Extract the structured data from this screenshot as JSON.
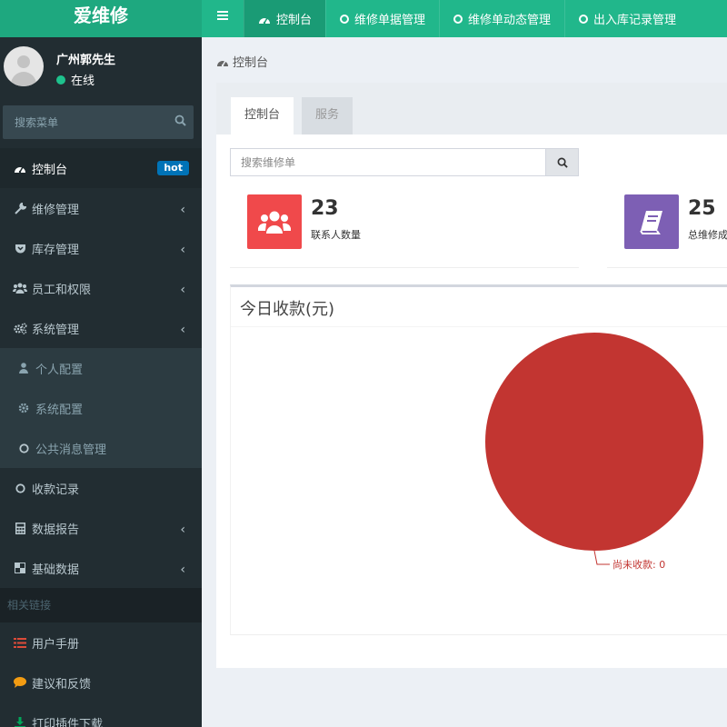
{
  "app": {
    "logo": "爱维修"
  },
  "topnav": {
    "tabs": [
      {
        "label": "控制台",
        "icon": "dashboard-icon",
        "active": true
      },
      {
        "label": "维修单据管理",
        "icon": "circle-icon",
        "active": false
      },
      {
        "label": "维修单动态管理",
        "icon": "circle-icon",
        "active": false
      },
      {
        "label": "出入库记录管理",
        "icon": "circle-icon",
        "active": false
      }
    ]
  },
  "user": {
    "name": "广州郭先生",
    "status": "在线"
  },
  "sidebar": {
    "search_placeholder": "搜索菜单",
    "items": [
      {
        "label": "控制台",
        "icon": "dashboard-icon",
        "badge": "hot",
        "active": true
      },
      {
        "label": "维修管理",
        "icon": "wrench-icon"
      },
      {
        "label": "库存管理",
        "icon": "shield-icon"
      },
      {
        "label": "员工和权限",
        "icon": "users-icon"
      },
      {
        "label": "系统管理",
        "icon": "gears-icon"
      },
      {
        "label": "个人配置",
        "icon": "user-icon"
      },
      {
        "label": "系统配置",
        "icon": "gear-icon"
      },
      {
        "label": "公共消息管理",
        "icon": "circle-icon"
      },
      {
        "label": "收款记录",
        "icon": "circle-icon"
      },
      {
        "label": "数据报告",
        "icon": "calculator-icon"
      },
      {
        "label": "基础数据",
        "icon": "grid-icon"
      }
    ],
    "links_header": "相关链接",
    "links": [
      {
        "label": "用户手册",
        "icon": "list-icon",
        "color": "#dd4b39"
      },
      {
        "label": "建议和反馈",
        "icon": "comment-icon",
        "color": "#f39c12"
      },
      {
        "label": "打印插件下载",
        "icon": "download-icon",
        "color": "#00a65a"
      }
    ]
  },
  "content": {
    "breadcrumb": "控制台",
    "tabs": [
      {
        "label": "控制台",
        "active": true
      },
      {
        "label": "服务",
        "active": false
      }
    ],
    "search_placeholder": "搜索维修单",
    "stats": [
      {
        "value": "23",
        "label": "联系人数量",
        "color": "#f0494b",
        "icon": "users-icon"
      },
      {
        "value": "25",
        "label": "总维修成",
        "color": "#7d5fb4",
        "icon": "book-icon"
      }
    ],
    "chart_title": "今日收款(元)"
  },
  "chart_data": {
    "type": "pie",
    "title": "今日收款(元)",
    "slices": [
      {
        "label": "尚未收款",
        "value": 0,
        "color": "#c23531",
        "data_label": "尚未收款: 0"
      }
    ]
  },
  "colors": {
    "brand": "#21b78b",
    "sidebar_bg": "#222d32",
    "badge": "#0073b7",
    "pie": "#c23531"
  }
}
